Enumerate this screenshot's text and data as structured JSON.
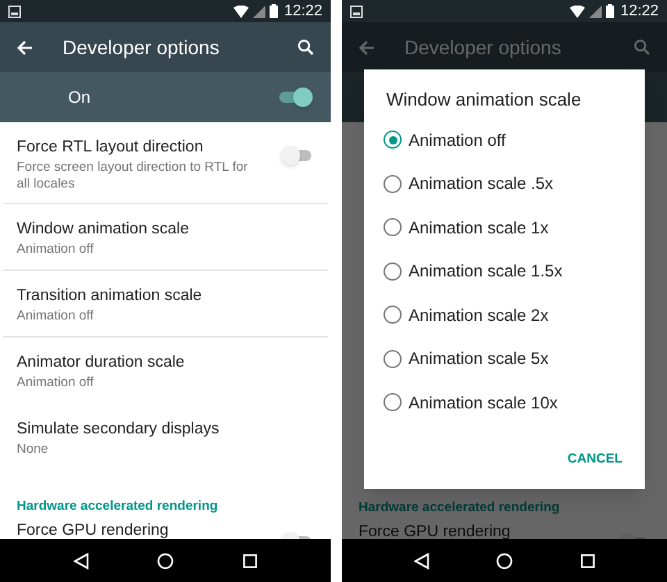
{
  "left_screen": {
    "status_bar": {
      "time": "12:22"
    },
    "toolbar": {
      "title": "Developer options"
    },
    "master_switch": {
      "label": "On",
      "on": true
    },
    "items": [
      {
        "kind": "switch",
        "title": "Force RTL layout direction",
        "subtitle": "Force screen layout direction to RTL for all locales",
        "on": false
      },
      {
        "kind": "pref",
        "title": "Window animation scale",
        "subtitle": "Animation off"
      },
      {
        "kind": "pref",
        "title": "Transition animation scale",
        "subtitle": "Animation off"
      },
      {
        "kind": "pref",
        "title": "Animator duration scale",
        "subtitle": "Animation off"
      },
      {
        "kind": "pref",
        "title": "Simulate secondary displays",
        "subtitle": "None"
      },
      {
        "kind": "header",
        "title": "Hardware accelerated rendering"
      },
      {
        "kind": "switch",
        "title": "Force GPU rendering",
        "on": false
      }
    ]
  },
  "right_screen": {
    "status_bar": {
      "time": "12:22"
    },
    "toolbar": {
      "title": "Developer options"
    },
    "items": [
      {
        "kind": "header",
        "title": "Hardware accelerated rendering"
      },
      {
        "kind": "switch",
        "title": "Force GPU rendering",
        "on": false
      }
    ],
    "dialog": {
      "title": "Window animation scale",
      "options": [
        {
          "label": "Animation off",
          "selected": true
        },
        {
          "label": "Animation scale .5x",
          "selected": false
        },
        {
          "label": "Animation scale 1x",
          "selected": false
        },
        {
          "label": "Animation scale 1.5x",
          "selected": false
        },
        {
          "label": "Animation scale 2x",
          "selected": false
        },
        {
          "label": "Animation scale 5x",
          "selected": false
        },
        {
          "label": "Animation scale 10x",
          "selected": false
        }
      ],
      "button": "CANCEL"
    }
  }
}
